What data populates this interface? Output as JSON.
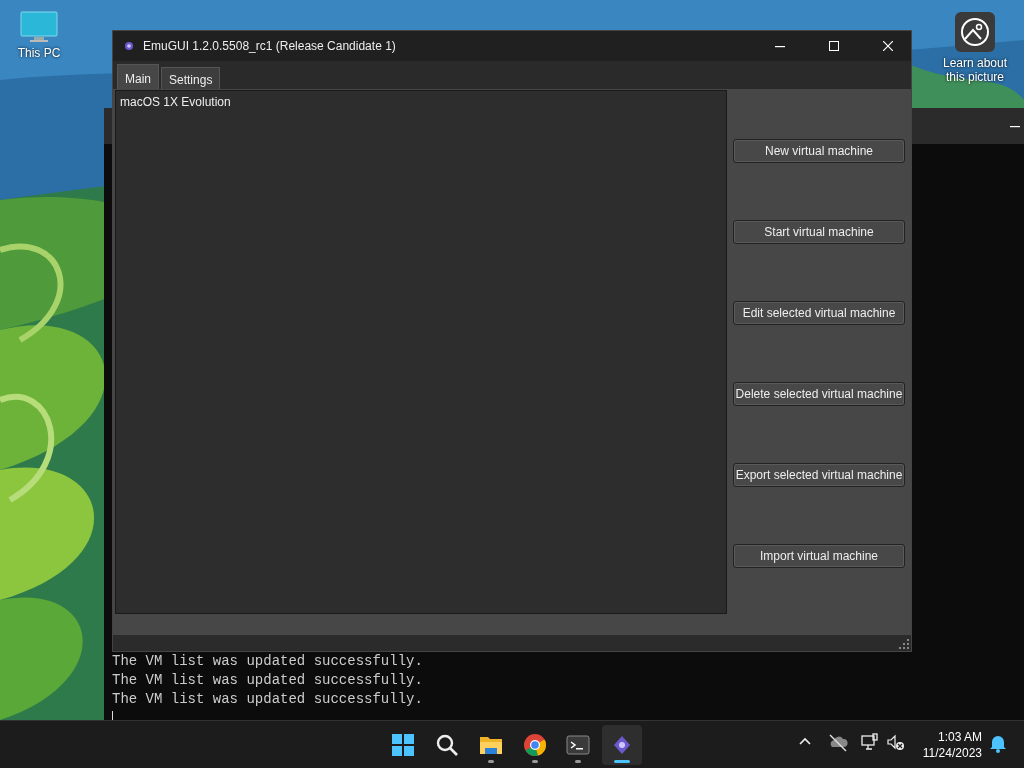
{
  "desktop": {
    "icons": [
      {
        "label": "This PC"
      }
    ],
    "spotlight": {
      "label": "Learn about this picture"
    }
  },
  "console": {
    "lines": [
      "The VM list was updated successfully.",
      "The VM list was updated successfully.",
      "The VM list was updated successfully."
    ]
  },
  "window": {
    "title": "EmuGUI 1.2.0.5508_rc1 (Release Candidate 1)",
    "tabs": [
      {
        "label": "Main",
        "selected": true
      },
      {
        "label": "Settings",
        "selected": false
      }
    ],
    "vm_list": [
      {
        "name": "macOS 1X Evolution"
      }
    ],
    "buttons": [
      "New virtual machine",
      "Start virtual machine",
      "Edit selected virtual machine",
      "Delete selected virtual machine",
      "Export selected virtual machine",
      "Import virtual machine"
    ]
  },
  "taskbar": {
    "apps": [
      {
        "kind": "start",
        "running": false,
        "active": false
      },
      {
        "kind": "search",
        "running": false,
        "active": false
      },
      {
        "kind": "folder",
        "running": true,
        "active": false
      },
      {
        "kind": "browser",
        "running": true,
        "active": false
      },
      {
        "kind": "terminal",
        "running": true,
        "active": false
      },
      {
        "kind": "emugui",
        "running": true,
        "active": true
      }
    ],
    "clock": {
      "time": "1:03 AM",
      "date": "11/24/2023"
    }
  }
}
